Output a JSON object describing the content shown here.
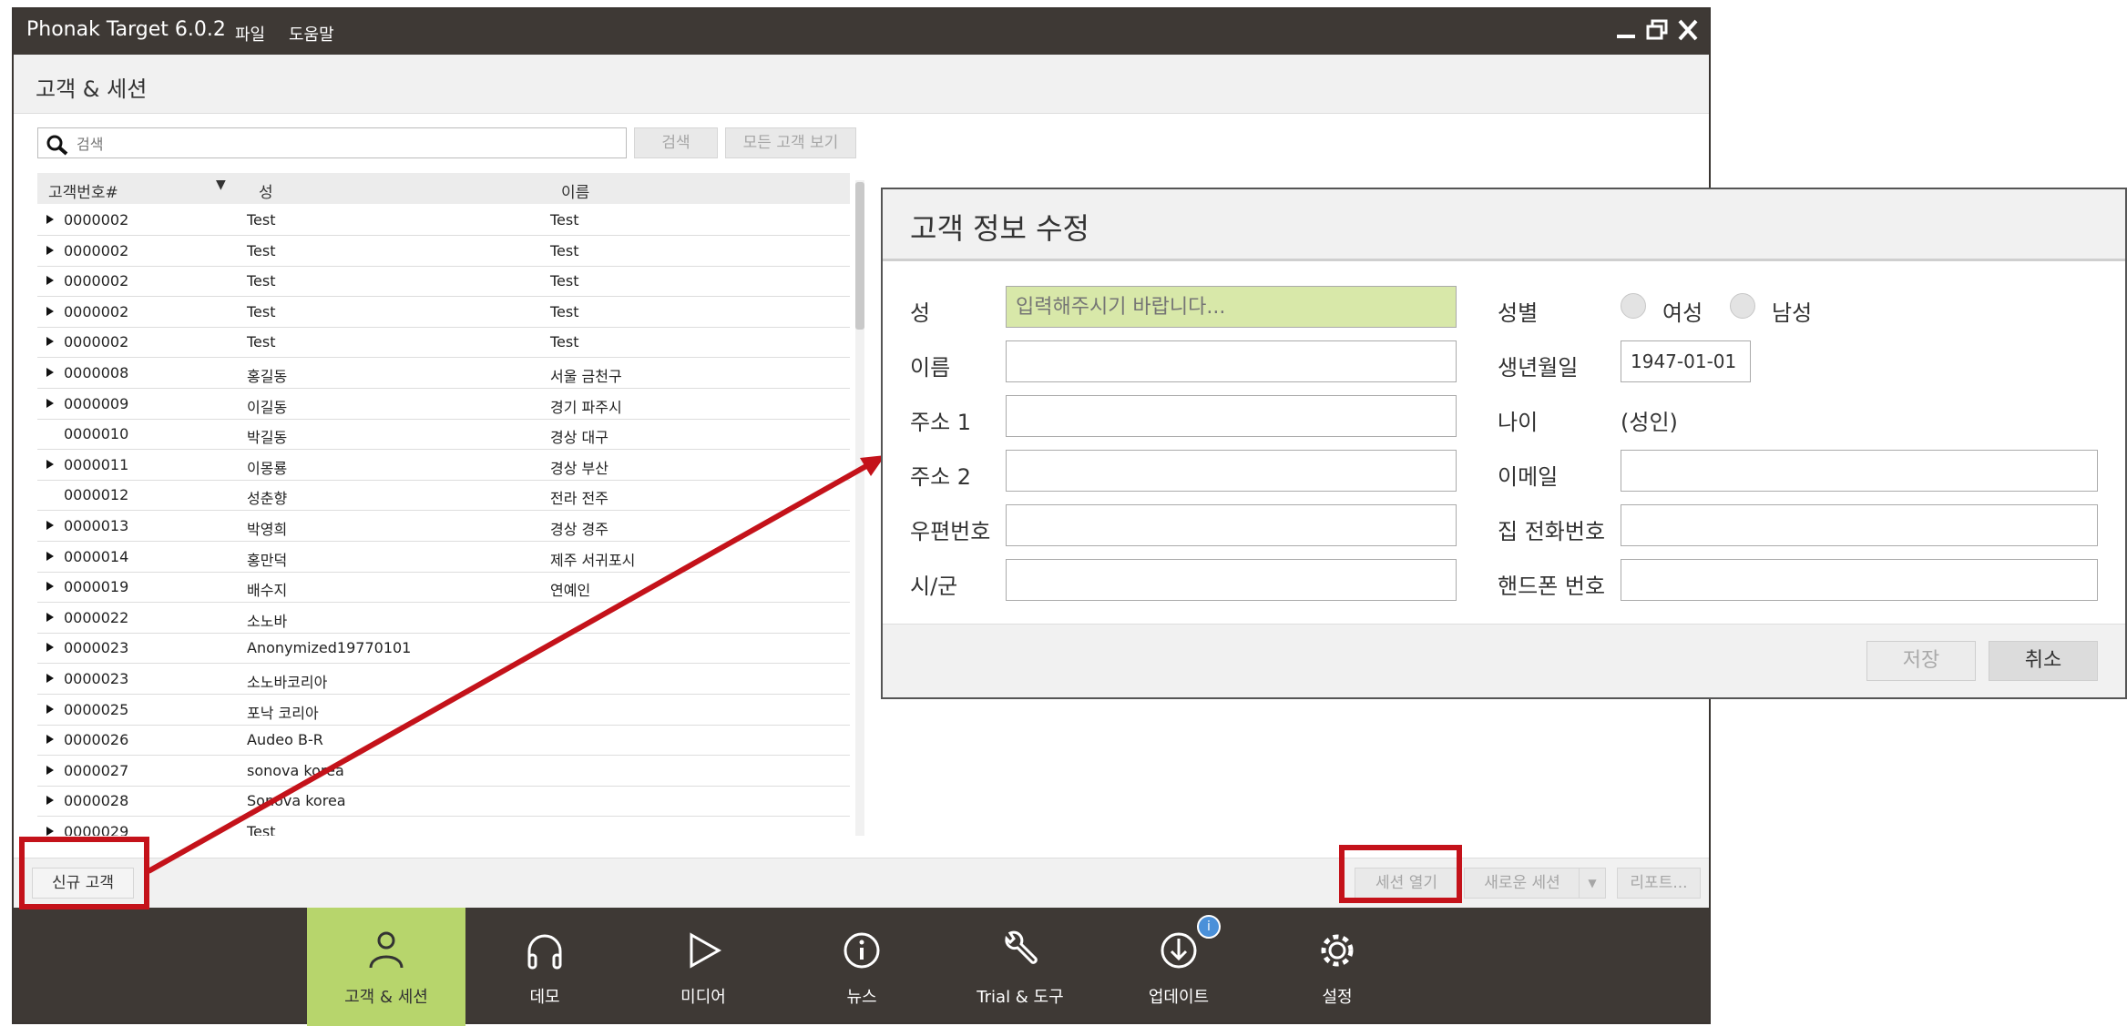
{
  "app": {
    "title": "Phonak Target 6.0.2",
    "menu": [
      "파일",
      "도움말"
    ],
    "section_title": "고객 & 세션"
  },
  "search": {
    "placeholder": "검색",
    "search_label": "검색",
    "show_all_label": "모든 고객 보기"
  },
  "table": {
    "columns": [
      "고객번호#",
      "성",
      "이름"
    ],
    "rows": [
      {
        "id": "0000002",
        "last": "Test",
        "first": "Test",
        "expand": true
      },
      {
        "id": "0000002",
        "last": "Test",
        "first": "Test",
        "expand": true
      },
      {
        "id": "0000002",
        "last": "Test",
        "first": "Test",
        "expand": true
      },
      {
        "id": "0000002",
        "last": "Test",
        "first": "Test",
        "expand": true
      },
      {
        "id": "0000002",
        "last": "Test",
        "first": "Test",
        "expand": true
      },
      {
        "id": "0000008",
        "last": "홍길동",
        "first": "서울 금천구",
        "expand": true
      },
      {
        "id": "0000009",
        "last": "이길동",
        "first": "경기 파주시",
        "expand": true
      },
      {
        "id": "0000010",
        "last": "박길동",
        "first": "경상 대구",
        "expand": false
      },
      {
        "id": "0000011",
        "last": "이몽룡",
        "first": "경상 부산",
        "expand": true
      },
      {
        "id": "0000012",
        "last": "성춘향",
        "first": "전라 전주",
        "expand": false
      },
      {
        "id": "0000013",
        "last": "박영희",
        "first": "경상 경주",
        "expand": true
      },
      {
        "id": "0000014",
        "last": "홍만덕",
        "first": "제주 서귀포시",
        "expand": true
      },
      {
        "id": "0000019",
        "last": "배수지",
        "first": "연예인",
        "expand": true
      },
      {
        "id": "0000022",
        "last": "소노바",
        "first": "",
        "expand": true
      },
      {
        "id": "0000023",
        "last": "Anonymized19770101",
        "first": "",
        "expand": true
      },
      {
        "id": "0000023",
        "last": "소노바코리아",
        "first": "",
        "expand": true
      },
      {
        "id": "0000025",
        "last": "포낙 코리아",
        "first": "",
        "expand": true
      },
      {
        "id": "0000026",
        "last": "Audeo B-R",
        "first": "",
        "expand": true
      },
      {
        "id": "0000027",
        "last": "sonova korea",
        "first": "",
        "expand": true
      },
      {
        "id": "0000028",
        "last": "Sonova korea",
        "first": "",
        "expand": true
      },
      {
        "id": "0000029",
        "last": "Test",
        "first": "",
        "expand": true
      }
    ]
  },
  "buttons": {
    "new_client": "신규 고객",
    "open_session": "세션 열기",
    "new_session": "새로운 세션",
    "report": "리포트..."
  },
  "nav": [
    {
      "label": "고객 & 세션",
      "icon": "person-icon",
      "active": true
    },
    {
      "label": "데모",
      "icon": "headphones-icon",
      "active": false
    },
    {
      "label": "미디어",
      "icon": "play-icon",
      "active": false
    },
    {
      "label": "뉴스",
      "icon": "info-icon",
      "active": false
    },
    {
      "label": "Trial & 도구",
      "icon": "wrench-icon",
      "active": false
    },
    {
      "label": "업데이트",
      "icon": "download-icon",
      "active": false
    },
    {
      "label": "설정",
      "icon": "gear-icon",
      "active": false
    }
  ],
  "dialog": {
    "title": "고객 정보 수정",
    "labels": {
      "last_name": "성",
      "first_name": "이름",
      "address1": "주소 1",
      "address2": "주소 2",
      "postal": "우편번호",
      "city": "시/군",
      "gender": "성별",
      "female": "여성",
      "male": "남성",
      "birth": "생년월일",
      "age": "나이",
      "email": "이메일",
      "home_phone": "집 전화번호",
      "mobile": "핸드폰 번호"
    },
    "placeholder_last_name": "입력해주시기 바랍니다...",
    "birth_value": "1947-01-01",
    "age_value": "(성인)",
    "save_label": "저장",
    "cancel_label": "취소"
  },
  "colors": {
    "accent": "#b7d56c",
    "highlight": "#c4121a",
    "titlebar": "#3e3935"
  }
}
